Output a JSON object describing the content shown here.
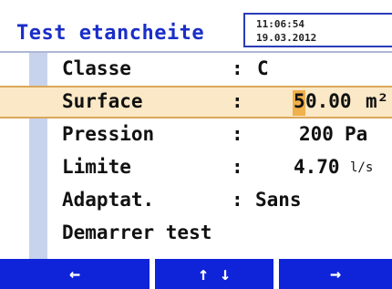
{
  "header": {
    "title": "Test etancheite",
    "time": "11:06:54",
    "date": "19.03.2012"
  },
  "rows": [
    {
      "label": "Classe",
      "sep": ":",
      "value": "C",
      "unit": ""
    },
    {
      "label": "Surface",
      "sep": ":",
      "value_first": "5",
      "value_rest": "0.00",
      "unit": "m²",
      "selected": true
    },
    {
      "label": "Pression",
      "sep": ":",
      "value": "200",
      "unit": "Pa"
    },
    {
      "label": "Limite",
      "sep": ":",
      "value": "4.70",
      "unit": "l/s"
    },
    {
      "label": "Adaptat.",
      "sep": ":",
      "value": "Sans",
      "unit": ""
    },
    {
      "label": "Demarrer test"
    }
  ],
  "softkeys": [
    {
      "label": "←",
      "icon": "arrow-left-icon"
    },
    {
      "label": "↑ ↓",
      "icon": "arrow-up-down-icon"
    },
    {
      "label": "→",
      "icon": "arrow-right-icon"
    }
  ],
  "colors": {
    "title": "#1a2ec8",
    "softkey_bg": "#0f24d8",
    "selection_bg": "#fbe8c6",
    "cursor": "#f0b04a",
    "accent": "#c7d2ec"
  }
}
